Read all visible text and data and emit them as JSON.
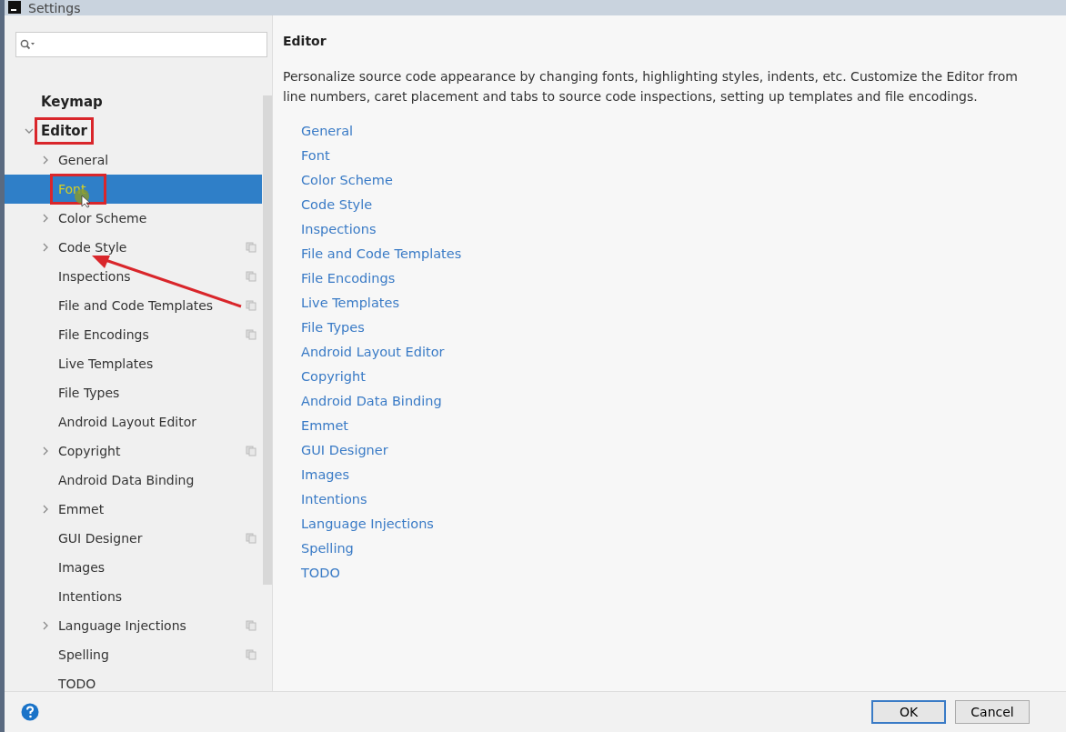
{
  "window": {
    "title": "Settings"
  },
  "sidebar": {
    "items": [
      {
        "label": "Keymap",
        "expandable": false,
        "outlined": false
      },
      {
        "label": "Editor",
        "expanded": true,
        "expandable": true,
        "outlined": true,
        "children": [
          {
            "label": "General",
            "expandable": true,
            "project": false,
            "selected": false,
            "outlined": false,
            "arrow_target": false
          },
          {
            "label": "Font",
            "expandable": false,
            "project": false,
            "selected": true,
            "outlined": true,
            "arrow_target": false
          },
          {
            "label": "Color Scheme",
            "expandable": true,
            "project": false,
            "selected": false,
            "outlined": false,
            "arrow_target": false
          },
          {
            "label": "Code Style",
            "expandable": true,
            "project": true,
            "selected": false,
            "outlined": false,
            "arrow_target": true
          },
          {
            "label": "Inspections",
            "expandable": false,
            "project": true,
            "selected": false,
            "outlined": false,
            "arrow_target": false
          },
          {
            "label": "File and Code Templates",
            "expandable": false,
            "project": true,
            "selected": false,
            "outlined": false,
            "arrow_target": false
          },
          {
            "label": "File Encodings",
            "expandable": false,
            "project": true,
            "selected": false,
            "outlined": false,
            "arrow_target": false
          },
          {
            "label": "Live Templates",
            "expandable": false,
            "project": false,
            "selected": false,
            "outlined": false,
            "arrow_target": false
          },
          {
            "label": "File Types",
            "expandable": false,
            "project": false,
            "selected": false,
            "outlined": false,
            "arrow_target": false
          },
          {
            "label": "Android Layout Editor",
            "expandable": false,
            "project": false,
            "selected": false,
            "outlined": false,
            "arrow_target": false
          },
          {
            "label": "Copyright",
            "expandable": true,
            "project": true,
            "selected": false,
            "outlined": false,
            "arrow_target": false
          },
          {
            "label": "Android Data Binding",
            "expandable": false,
            "project": false,
            "selected": false,
            "outlined": false,
            "arrow_target": false
          },
          {
            "label": "Emmet",
            "expandable": true,
            "project": false,
            "selected": false,
            "outlined": false,
            "arrow_target": false
          },
          {
            "label": "GUI Designer",
            "expandable": false,
            "project": true,
            "selected": false,
            "outlined": false,
            "arrow_target": false
          },
          {
            "label": "Images",
            "expandable": false,
            "project": false,
            "selected": false,
            "outlined": false,
            "arrow_target": false
          },
          {
            "label": "Intentions",
            "expandable": false,
            "project": false,
            "selected": false,
            "outlined": false,
            "arrow_target": false
          },
          {
            "label": "Language Injections",
            "expandable": true,
            "project": true,
            "selected": false,
            "outlined": false,
            "arrow_target": false
          },
          {
            "label": "Spelling",
            "expandable": false,
            "project": true,
            "selected": false,
            "outlined": false,
            "arrow_target": false
          },
          {
            "label": "TODO",
            "expandable": false,
            "project": false,
            "selected": false,
            "outlined": false,
            "arrow_target": false
          }
        ]
      }
    ]
  },
  "content": {
    "title": "Editor",
    "description": "Personalize source code appearance by changing fonts, highlighting styles, indents, etc. Customize the Editor from line numbers, caret placement and tabs to source code inspections, setting up templates and file encodings.",
    "links": [
      "General",
      "Font",
      "Color Scheme",
      "Code Style",
      "Inspections",
      "File and Code Templates",
      "File Encodings",
      "Live Templates",
      "File Types",
      "Android Layout Editor",
      "Copyright",
      "Android Data Binding",
      "Emmet",
      "GUI Designer",
      "Images",
      "Intentions",
      "Language Injections",
      "Spelling",
      "TODO"
    ]
  },
  "buttons": [
    {
      "label": "OK",
      "default": true
    },
    {
      "label": "Cancel",
      "default": false
    }
  ]
}
